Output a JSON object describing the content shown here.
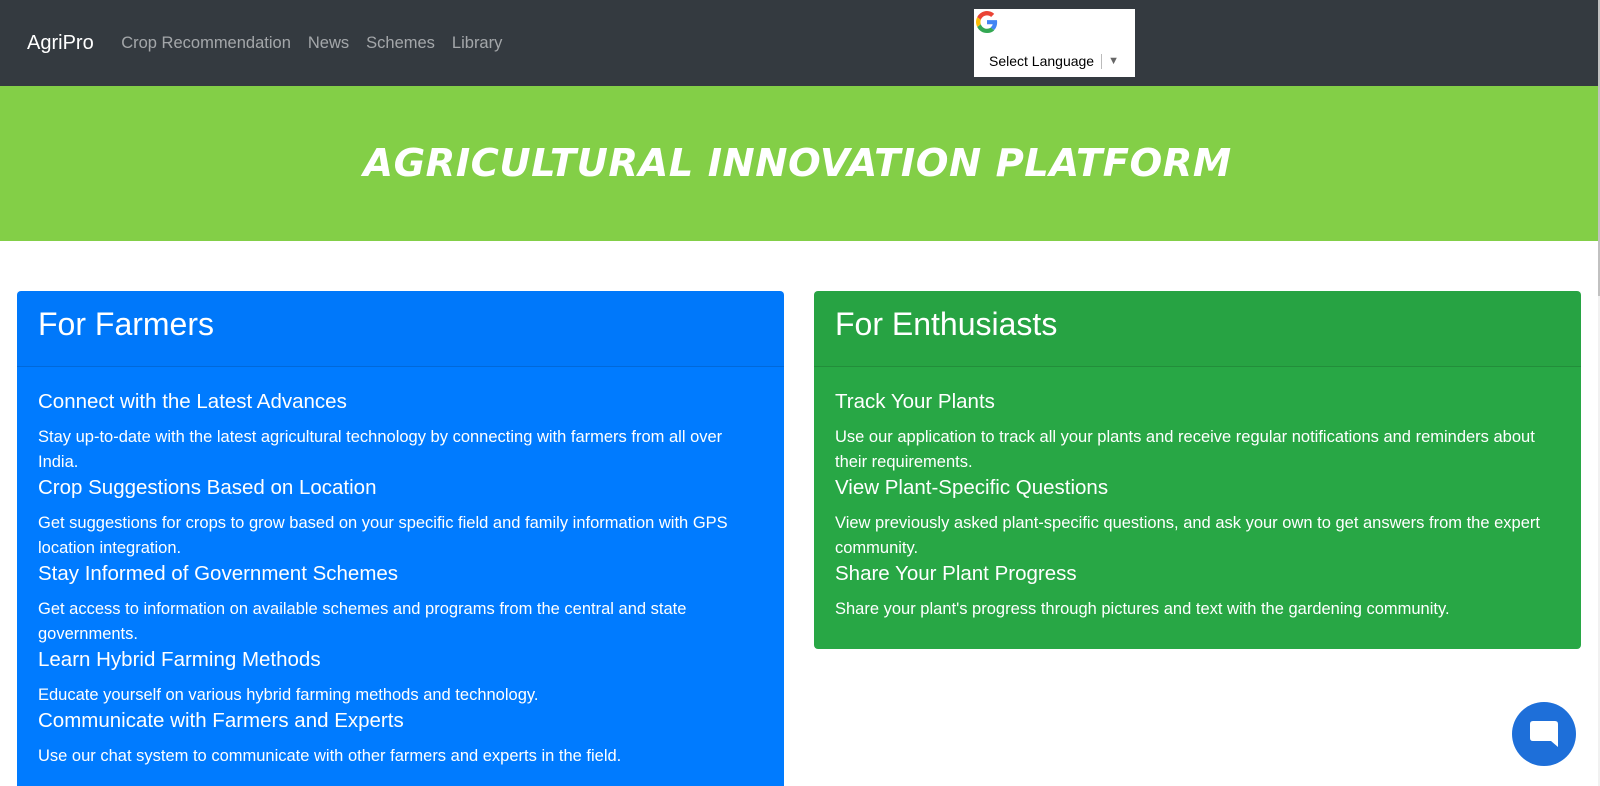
{
  "nav": {
    "brand": "AgriPro",
    "links": [
      "Crop Recommendation",
      "News",
      "Schemes",
      "Library"
    ],
    "language_select": "Select Language"
  },
  "hero": {
    "title": "AGRICULTURAL INNOVATION PLATFORM"
  },
  "farmers": {
    "title": "For Farmers",
    "features": [
      {
        "title": "Connect with the Latest Advances",
        "text": "Stay up-to-date with the latest agricultural technology by connecting with farmers from all over India."
      },
      {
        "title": "Crop Suggestions Based on Location",
        "text": "Get suggestions for crops to grow based on your specific field and family information with GPS location integration."
      },
      {
        "title": "Stay Informed of Government Schemes",
        "text": "Get access to information on available schemes and programs from the central and state governments."
      },
      {
        "title": "Learn Hybrid Farming Methods",
        "text": "Educate yourself on various hybrid farming methods and technology."
      },
      {
        "title": "Communicate with Farmers and Experts",
        "text": "Use our chat system to communicate with other farmers and experts in the field."
      }
    ]
  },
  "enthusiasts": {
    "title": "For Enthusiasts",
    "features": [
      {
        "title": "Track Your Plants",
        "text": "Use our application to track all your plants and receive regular notifications and reminders about their requirements."
      },
      {
        "title": "View Plant-Specific Questions",
        "text": "View previously asked plant-specific questions, and ask your own to get answers from the expert community."
      },
      {
        "title": "Share Your Plant Progress",
        "text": "Share your plant's progress through pictures and text with the gardening community."
      }
    ]
  },
  "colors": {
    "navbar": "#343a40",
    "hero": "#83cf47",
    "farmers_card": "#007bff",
    "enthusiasts_card": "#28a745",
    "chat_button": "#1e6fd9"
  },
  "icons": {
    "language": "google-icon",
    "language_dropdown": "chevron-down-icon",
    "chat": "chat-bubble-icon"
  }
}
